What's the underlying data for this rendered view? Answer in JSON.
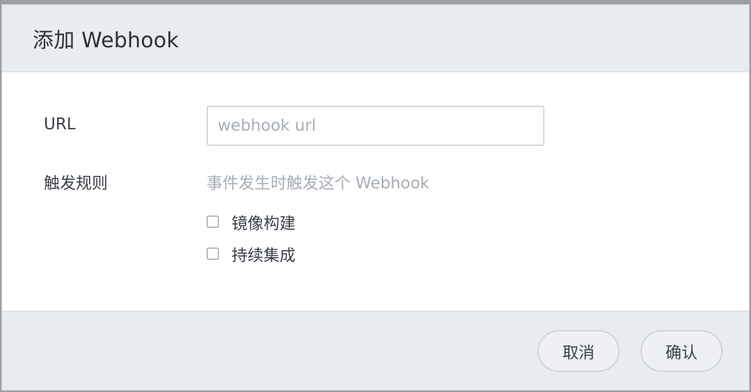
{
  "dialog": {
    "title": "添加 Webhook"
  },
  "form": {
    "url_label": "URL",
    "url_placeholder": "webhook url",
    "url_value": "",
    "trigger_label": "触发规则",
    "trigger_description": "事件发生时触发这个 Webhook",
    "options": [
      {
        "label": "镜像构建",
        "checked": false
      },
      {
        "label": "持续集成",
        "checked": false
      }
    ]
  },
  "footer": {
    "cancel_label": "取消",
    "confirm_label": "确认"
  }
}
